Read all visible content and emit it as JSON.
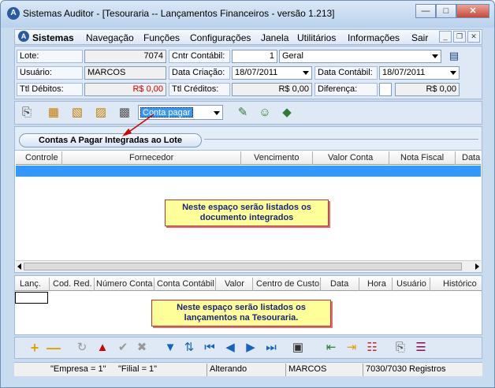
{
  "window": {
    "title": "Sistemas Auditor - [Tesouraria -- Lançamentos Financeiros - versão 1.213]",
    "app_icon": "auditor-logo-icon",
    "controls": [
      "minimize",
      "maximize",
      "close"
    ]
  },
  "menubar": {
    "brand": "Sistemas",
    "items": [
      "Navegação",
      "Funções",
      "Configurações",
      "Janela",
      "Utilitários",
      "Informações",
      "Sair"
    ]
  },
  "form": {
    "lote_label": "Lote:",
    "lote_value": "7074",
    "cntr_label": "Cntr Contábil:",
    "cntr_value": "1",
    "cntr_desc": "Geral",
    "usuario_label": "Usuário:",
    "usuario_value": "MARCOS",
    "data_criacao_label": "Data Criação:",
    "data_criacao_value": "18/07/2011",
    "data_contabil_label": "Data Contábil:",
    "data_contabil_value": "18/07/2011",
    "debitos_label": "Ttl Débitos:",
    "debitos_value": "R$ 0,00",
    "creditos_label": "Ttl Créditos:",
    "creditos_value": "R$ 0,00",
    "diferenca_label": "Diferença:",
    "diferenca_value": "R$ 0,00"
  },
  "toolbar1": {
    "combo_value": "Conta pagar",
    "icons": [
      "printer-icon",
      "cash-icon",
      "cash-edit-icon",
      "cash-delete-icon",
      "report-icon",
      "pencil-edit-icon",
      "user-edit-icon",
      "diamond-icon"
    ]
  },
  "upper_grid": {
    "group_button": "Contas A Pagar Integradas ao Lote",
    "columns": [
      "Controle",
      "Fornecedor",
      "Vencimento",
      "Valor Conta",
      "Nota Fiscal",
      "Data"
    ],
    "note": "Neste espaço serão listados os documento integrados"
  },
  "lower_grid": {
    "columns": [
      "Lanç.",
      "Cod. Red.",
      "Número Conta",
      "Conta Contábil",
      "Valor",
      "Centro de Custo",
      "Data",
      "Hora",
      "Usuário",
      "Histórico"
    ],
    "note": "Neste espaço serão listados os lançamentos na Tesouraria."
  },
  "toolbar2": {
    "icons": [
      "add-icon",
      "remove-icon",
      "refresh-icon",
      "warning-icon",
      "check-icon",
      "cancel-icon",
      "filter-icon",
      "sort-icon",
      "first-icon",
      "prev-icon",
      "next-icon",
      "last-icon",
      "save-icon",
      "import-icon",
      "export-icon",
      "calc-icon",
      "print-icon",
      "barcode-icon"
    ]
  },
  "status": {
    "empresa": "\"Empresa = 1\"",
    "filial": "\"Filial = 1\"",
    "mode": "Alterando",
    "user": "MARCOS",
    "records": "7030/7030 Registros"
  },
  "colors": {
    "selection": "#3399ff",
    "note_fill": "#ffff99",
    "note_text": "#1a237e",
    "red_value": "#d00000",
    "panel_bg": "#dfe9f5"
  }
}
